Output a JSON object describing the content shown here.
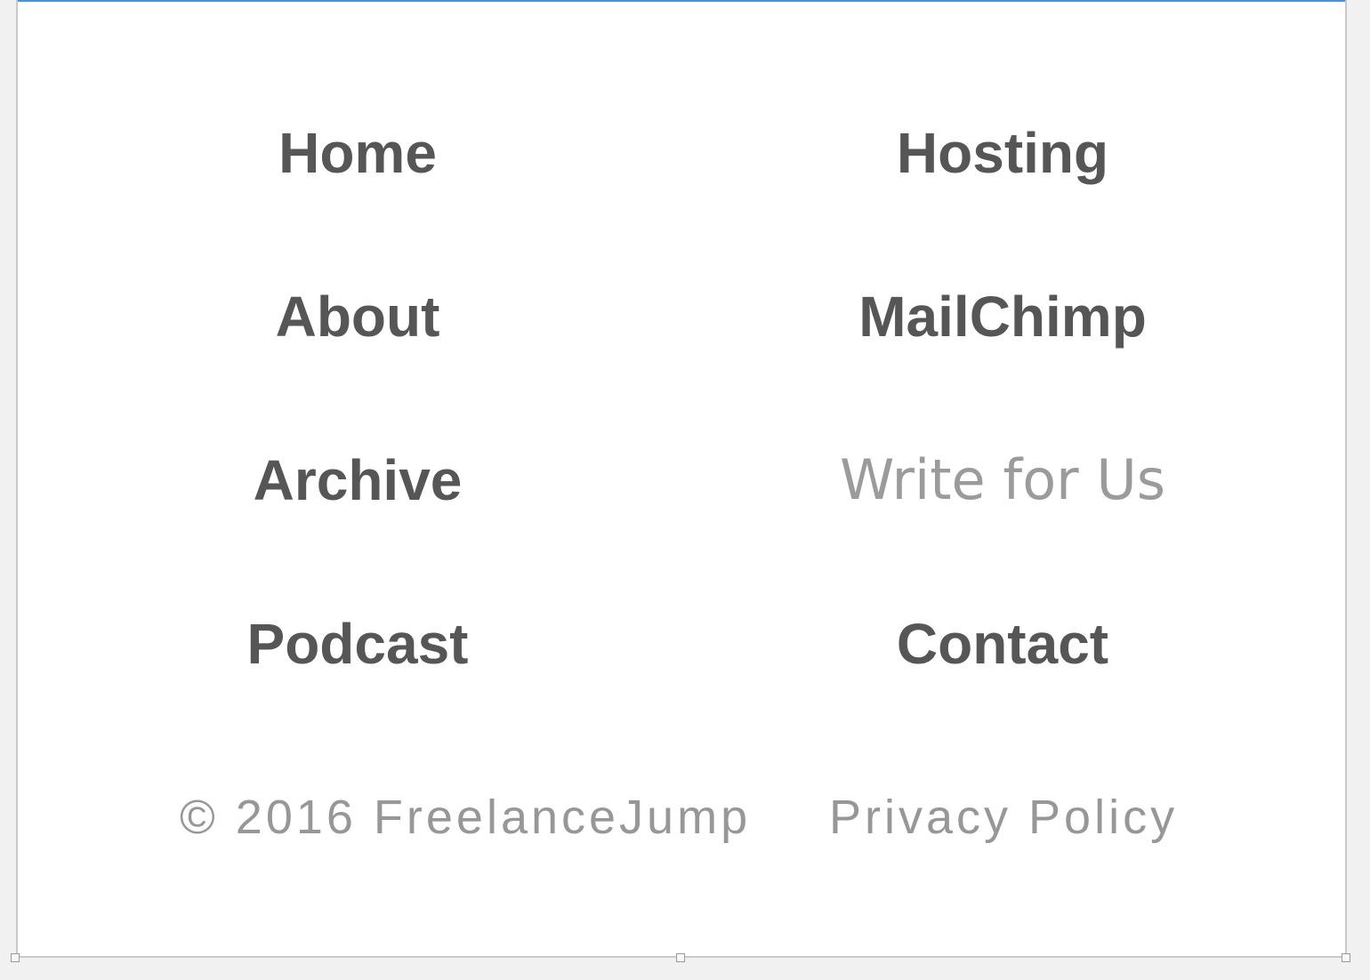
{
  "nav": {
    "left": [
      {
        "label": "Home"
      },
      {
        "label": "About"
      },
      {
        "label": "Archive"
      },
      {
        "label": "Podcast"
      }
    ],
    "right": [
      {
        "label": "Hosting"
      },
      {
        "label": "MailChimp"
      },
      {
        "label": "Write for Us"
      },
      {
        "label": "Contact"
      }
    ]
  },
  "footer": {
    "copyright": "© 2016 FreelanceJump",
    "privacy_label": "Privacy Policy"
  },
  "colors": {
    "link": "#565656",
    "muted": "#9b9b9b",
    "accent": "#4a90e2"
  }
}
